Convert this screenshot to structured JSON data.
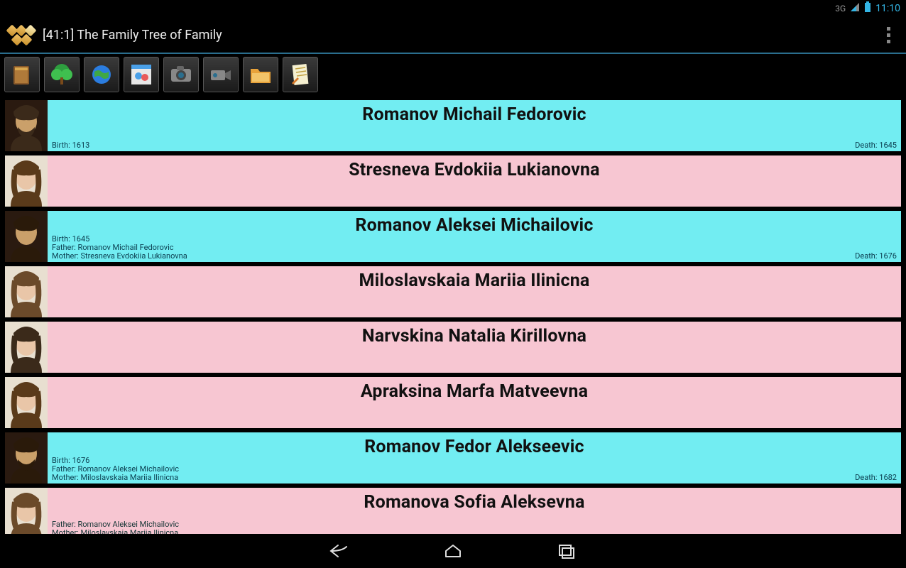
{
  "status": {
    "time": "11:10",
    "network": "3G"
  },
  "header": {
    "title": "[41:1] The Family Tree of Family"
  },
  "toolbar": {
    "items": [
      {
        "name": "book-icon"
      },
      {
        "name": "tree-icon"
      },
      {
        "name": "globe-icon"
      },
      {
        "name": "people-icon"
      },
      {
        "name": "camera-icon"
      },
      {
        "name": "video-icon"
      },
      {
        "name": "folder-icon"
      },
      {
        "name": "notes-icon"
      }
    ]
  },
  "people": [
    {
      "name": "Romanov Michail Fedorovic",
      "gender": "male",
      "birth": "Birth: 1613",
      "death": "Death: 1645",
      "father": "",
      "mother": ""
    },
    {
      "name": "Stresneva Evdokiia Lukianovna",
      "gender": "female",
      "birth": "",
      "death": "",
      "father": "",
      "mother": ""
    },
    {
      "name": "Romanov Aleksei Michailovic",
      "gender": "male",
      "birth": "Birth: 1645",
      "death": "Death: 1676",
      "father": "Father: Romanov Michail Fedorovic",
      "mother": "Mother: Stresneva Evdokiia Lukianovna"
    },
    {
      "name": "Miloslavskaia Mariia Ilinicna",
      "gender": "female",
      "birth": "",
      "death": "",
      "father": "",
      "mother": ""
    },
    {
      "name": "Narvskina Natalia Kirillovna",
      "gender": "female",
      "birth": "",
      "death": "",
      "father": "",
      "mother": ""
    },
    {
      "name": "Apraksina Marfa Matveevna",
      "gender": "female",
      "birth": "",
      "death": "",
      "father": "",
      "mother": ""
    },
    {
      "name": "Romanov Fedor Alekseevic",
      "gender": "male",
      "birth": "Birth: 1676",
      "death": "Death: 1682",
      "father": "Father: Romanov Aleksei Michailovic",
      "mother": "Mother: Miloslavskaia Mariia Ilinicna"
    },
    {
      "name": "Romanova Sofia Aleksevna",
      "gender": "female",
      "birth": "",
      "death": "",
      "father": "Father: Romanov Aleksei Michailovic",
      "mother": "Mother: Miloslavskaia Mariia Ilinicna"
    }
  ]
}
